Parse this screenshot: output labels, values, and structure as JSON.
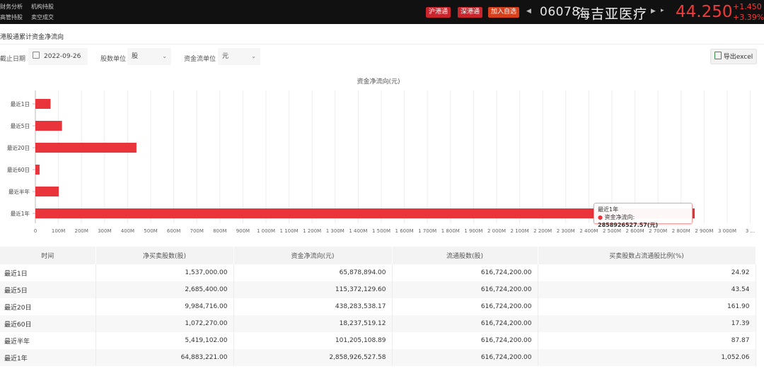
{
  "topbar": {
    "nav_row1": [
      "财务分析",
      "机构持股"
    ],
    "nav_row2": [
      "高管持股",
      "卖空成交"
    ],
    "btn_sh": "沪港通",
    "btn_sz": "深港通",
    "btn_watch": "加入自选",
    "prev_icon": "◀",
    "next_icon": "▶",
    "next_small_icon": "▸",
    "stock_code": "06078",
    "stock_name": "海吉亚医疗",
    "price": "44.250",
    "change": "+1.450",
    "change_pct": "+3.39%"
  },
  "section": {
    "title": "港股通累计资金净流向"
  },
  "filters": {
    "date_label": "截止日期",
    "date_value": "2022-09-26",
    "share_unit_label": "股数单位",
    "share_unit_value": "股",
    "money_unit_label": "资金流单位",
    "money_unit_value": "元",
    "export_label": "导出excel"
  },
  "colors": {
    "accent": "#e8343a",
    "topbar": "#111111"
  },
  "chart_data": {
    "type": "bar",
    "orientation": "horizontal",
    "title": "资金净流向(元)",
    "categories": [
      "最近1日",
      "最近5日",
      "最近20日",
      "最近60日",
      "最近半年",
      "最近1年"
    ],
    "values": [
      65878894.0,
      115372129.6,
      438283538.17,
      18237519.12,
      101205108.89,
      2858926527.58
    ],
    "xlim": [
      0,
      3050000000
    ],
    "x_ticks": [
      "0",
      "100M",
      "200M",
      "300M",
      "400M",
      "500M",
      "600M",
      "700M",
      "800M",
      "900M",
      "1 000M",
      "1 100M",
      "1 200M",
      "1 300M",
      "1 400M",
      "1 500M",
      "1 600M",
      "1 700M",
      "1 800M",
      "1 900M",
      "2 000M",
      "2 100M",
      "2 200M",
      "2 300M",
      "2 400M",
      "2 500M",
      "2 600M",
      "2 700M",
      "2 800M",
      "2 900M",
      "3 000M",
      "3 ..."
    ],
    "grid": true,
    "color": "#e8343a"
  },
  "tooltip": {
    "category": "最近1年",
    "series_label": "资金净流向:",
    "value": "2858926527.57(元)"
  },
  "table": {
    "headers": [
      "时间",
      "净买卖股数(股)",
      "资金净流向(元)",
      "流通股数(股)",
      "买卖股数占流通股比例(%)"
    ],
    "rows": [
      [
        "最近1日",
        "1,537,000.00",
        "65,878,894.00",
        "616,724,200.00",
        "24.92"
      ],
      [
        "最近5日",
        "2,685,400.00",
        "115,372,129.60",
        "616,724,200.00",
        "43.54"
      ],
      [
        "最近20日",
        "9,984,716.00",
        "438,283,538.17",
        "616,724,200.00",
        "161.90"
      ],
      [
        "最近60日",
        "1,072,270.00",
        "18,237,519.12",
        "616,724,200.00",
        "17.39"
      ],
      [
        "最近半年",
        "5,419,102.00",
        "101,205,108.89",
        "616,724,200.00",
        "87.87"
      ],
      [
        "最近1年",
        "64,883,221.00",
        "2,858,926,527.58",
        "616,724,200.00",
        "1,052.06"
      ]
    ]
  }
}
